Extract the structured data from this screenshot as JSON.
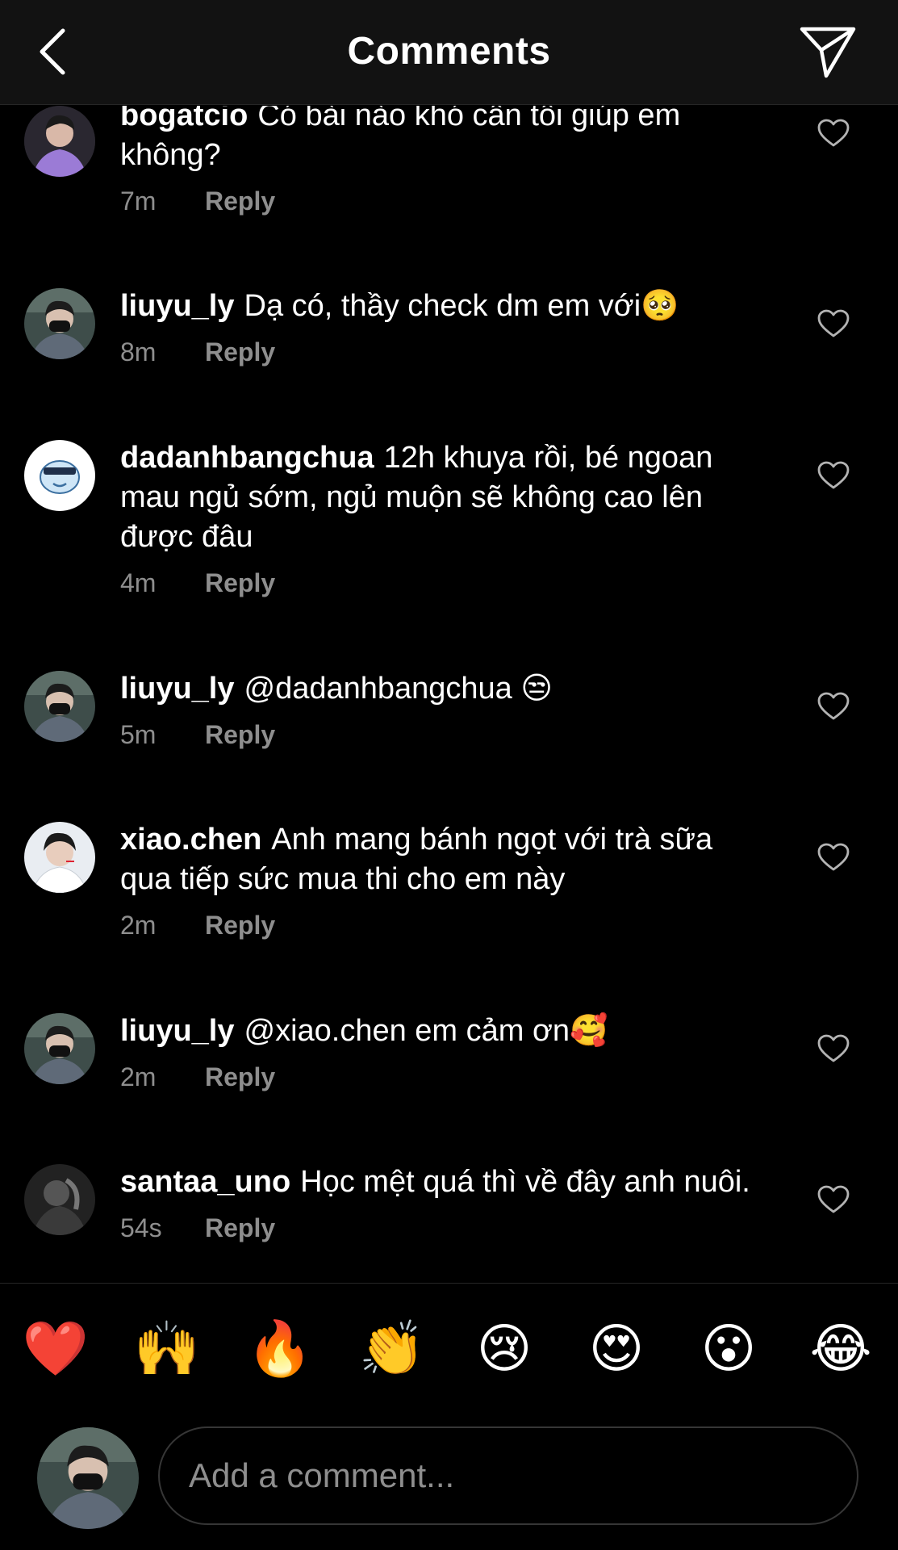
{
  "header": {
    "title": "Comments"
  },
  "comments": [
    {
      "user": "bogatcio",
      "text": "Có bài nào khó cần tôi giúp em không?",
      "time": "7m",
      "reply": "Reply"
    },
    {
      "user": "liuyu_ly",
      "text": "Dạ có, thầy check dm em với🥺",
      "time": "8m",
      "reply": "Reply"
    },
    {
      "user": "dadanhbangchua",
      "text": "12h khuya rồi, bé ngoan mau ngủ sớm, ngủ muộn sẽ không cao lên được đâu",
      "time": "4m",
      "reply": "Reply"
    },
    {
      "user": "liuyu_ly",
      "text": "@dadanhbangchua 😒",
      "time": "5m",
      "reply": "Reply"
    },
    {
      "user": "xiao.chen",
      "text": "Anh mang bánh ngọt với trà sữa qua tiếp sức mua thi cho em này",
      "time": "2m",
      "reply": "Reply"
    },
    {
      "user": "liuyu_ly",
      "text": "@xiao.chen em cảm ơn🥰",
      "time": "2m",
      "reply": "Reply"
    },
    {
      "user": "santaa_uno",
      "text": "Học mệt quá thì về đây anh nuôi.",
      "time": "54s",
      "reply": "Reply"
    }
  ],
  "emoji_bar": [
    "❤️",
    "🙌",
    "🔥",
    "👏",
    "😢",
    "😍",
    "😮",
    "😂"
  ],
  "composer": {
    "placeholder": "Add a comment..."
  }
}
